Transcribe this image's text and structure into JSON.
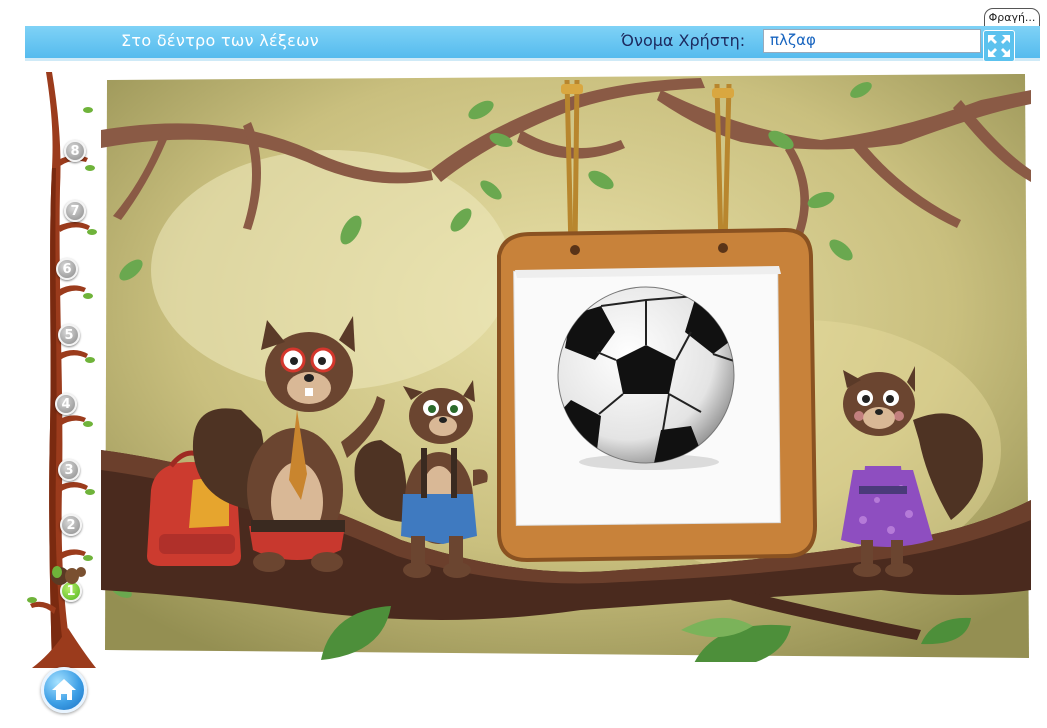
{
  "window": {
    "exit_tab": "Φραγή..."
  },
  "header": {
    "title": "Στο δέντρο των λέξεων",
    "user_label": "Όνομα Χρήστη:",
    "user_value": "πλζαφ"
  },
  "levels": [
    "8",
    "7",
    "6",
    "5",
    "4",
    "3",
    "2",
    "1"
  ],
  "current_level": "1",
  "card": {
    "picture": "soccer-ball"
  },
  "colors": {
    "header": "#55bbee",
    "active_level": "#4fb31c",
    "inactive_level": "#8a8a8a"
  }
}
